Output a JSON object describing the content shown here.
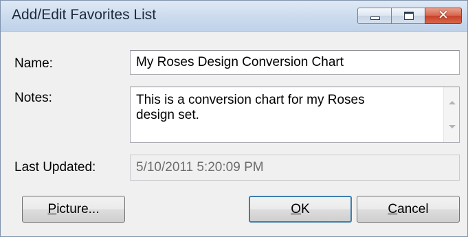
{
  "window": {
    "title": "Add/Edit Favorites List",
    "controls": [
      "minimize-icon",
      "maximize-icon",
      "close-icon"
    ],
    "close_glyph": "✕"
  },
  "form": {
    "name_label": "Name:",
    "name_value": "My Roses Design Conversion Chart",
    "notes_label": "Notes:",
    "notes_value": "This is a conversion chart for my Roses\ndesign set.",
    "updated_label": "Last Updated:",
    "updated_value": "5/10/2011 5:20:09 PM"
  },
  "buttons": {
    "picture": {
      "mnemonic": "P",
      "rest": "icture..."
    },
    "ok": {
      "mnemonic": "O",
      "rest": "K"
    },
    "cancel": {
      "mnemonic": "C",
      "rest": "ancel"
    }
  },
  "colors": {
    "titlebar": "#cddcee",
    "close_button": "#c8412a",
    "default_button_border": "#3c7fb1"
  }
}
